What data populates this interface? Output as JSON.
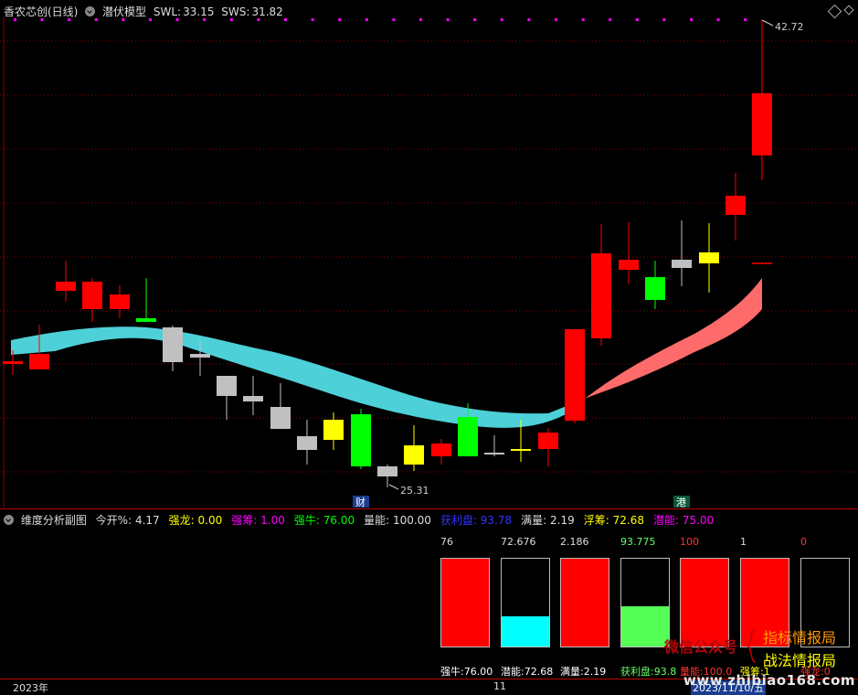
{
  "header": {
    "title": "香农芯创(日线)",
    "indicator": "潜伏模型",
    "swl_label": "SWL:",
    "swl_value": "33.15",
    "sws_label": "SWS:",
    "sws_value": "31.82"
  },
  "main": {
    "high_label": "42.72",
    "low_label": "25.31",
    "marker_cai": "财",
    "marker_gang": "港"
  },
  "sub": {
    "title": "维度分析副图",
    "params": [
      {
        "label": "今开%:",
        "value": "4.17",
        "color": "#dddddd"
      },
      {
        "label": "强龙:",
        "value": "0.00",
        "color": "#ffff00"
      },
      {
        "label": "强筹:",
        "value": "1.00",
        "color": "#ff00ff"
      },
      {
        "label": "强牛:",
        "value": "76.00",
        "color": "#00ff00"
      },
      {
        "label": "量能:",
        "value": "100.00",
        "color": "#dddddd"
      },
      {
        "label": "获利盘:",
        "value": "93.78",
        "color": "#3333ff"
      },
      {
        "label": "满量:",
        "value": "2.19",
        "color": "#dddddd"
      },
      {
        "label": "浮筹:",
        "value": "72.68",
        "color": "#ffff00"
      },
      {
        "label": "潜能:",
        "value": "75.00",
        "color": "#ff00ff"
      }
    ],
    "boxes": [
      {
        "top": "76",
        "bottom": "强牛:76.00",
        "top_color": "#dddddd",
        "bottom_color": "#ffffff",
        "fill_color": "#ff0000",
        "fill_fraction": 1.0
      },
      {
        "top": "72.676",
        "bottom": "潜能:72.68",
        "top_color": "#dddddd",
        "bottom_color": "#ffffff",
        "fill_color": "#00ffff",
        "fill_fraction": 0.34
      },
      {
        "top": "2.186",
        "bottom": "满量:2.19",
        "top_color": "#dddddd",
        "bottom_color": "#ffffff",
        "fill_color": "#ff0000",
        "fill_fraction": 1.0
      },
      {
        "top": "93.775",
        "bottom": "获利盘:93.8",
        "top_color": "#66ff66",
        "bottom_color": "#66ff66",
        "fill_color": "#55ff55",
        "fill_fraction": 0.46
      },
      {
        "top": "100",
        "bottom": "量能:100.0",
        "top_color": "#ff3333",
        "bottom_color": "#ff3333",
        "fill_color": "#ff0000",
        "fill_fraction": 1.0
      },
      {
        "top": "1",
        "bottom": "强筹:1",
        "top_color": "#dddddd",
        "bottom_color": "#ffff00",
        "fill_color": "#ff0000",
        "fill_fraction": 1.0
      },
      {
        "top": "0",
        "bottom": "强龙:0",
        "top_color": "#ff3333",
        "bottom_color": "#ff3333",
        "fill_color": "#000000",
        "fill_fraction": 0.0
      }
    ],
    "watermark": {
      "line1": "微信公众号",
      "line2": "指标情报局",
      "line3": "战法情报局",
      "line4": "www.zhibiao168.com"
    }
  },
  "time_axis": {
    "year": "2023年",
    "month": "11",
    "date": "2023/11/10/五"
  },
  "colors": {
    "up": "#ff0000",
    "down_gray": "#c0c0c0",
    "green": "#00ff00",
    "yellow": "#ffff00",
    "band_cyan": "#4dd0d8",
    "band_red": "#ff6b6b",
    "grid": "#8b0000"
  }
}
